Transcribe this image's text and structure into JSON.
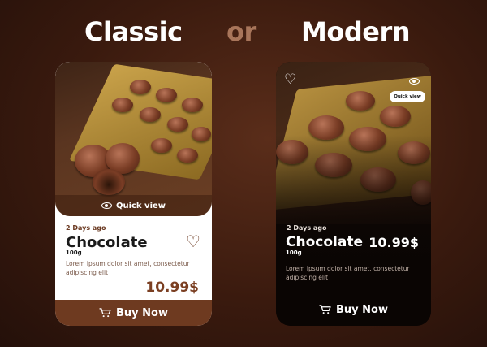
{
  "headline": {
    "left": "Classic",
    "middle": "or",
    "right": "Modern"
  },
  "classic": {
    "quick_view_label": "Quick view",
    "date": "2 Days ago",
    "title": "Chocolate",
    "weight": "100g",
    "description": "Lorem ipsum dolor sit amet, consectetur adipiscing elit",
    "price": "10.99$",
    "buy_label": "Buy Now",
    "icons": [
      "eye-icon",
      "heart-outline-icon",
      "cart-icon"
    ],
    "colors": {
      "accent": "#6e3a20",
      "price": "#7b3f22",
      "card_bg": "#ffffff"
    }
  },
  "modern": {
    "quick_view_label": "Quick view",
    "date": "2 Days ago",
    "title": "Chocolate",
    "weight": "100g",
    "price": "10.99$",
    "description": "Lorem ipsum dolor sit amet, consectetur adipiscing elit",
    "buy_label": "Buy Now",
    "icons": [
      "heart-outline-icon",
      "eye-icon",
      "cart-icon"
    ],
    "colors": {
      "card_bg": "#0c0604",
      "text": "#ffffff"
    }
  }
}
